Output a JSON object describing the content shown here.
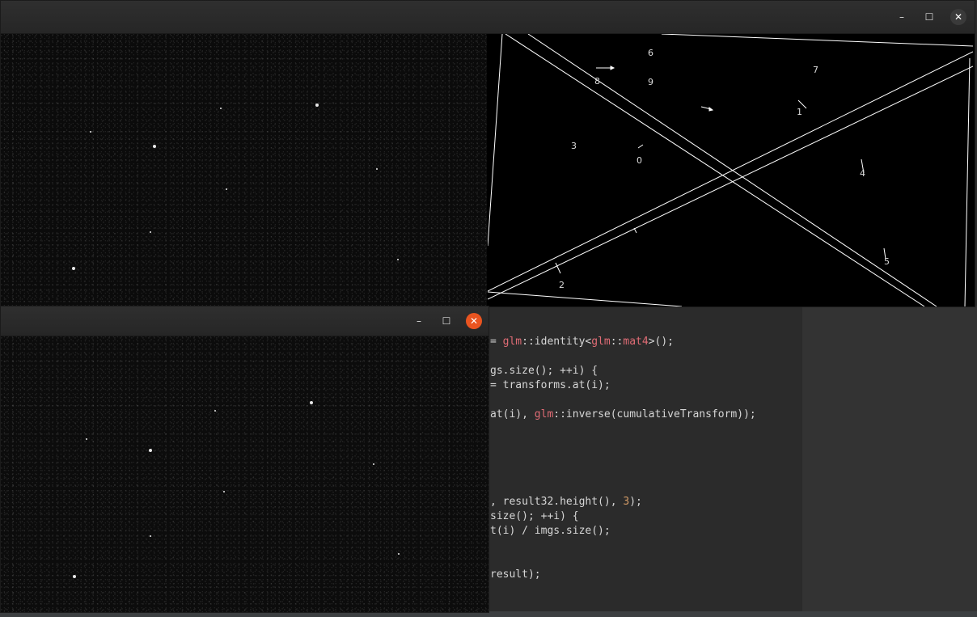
{
  "editor": {
    "lines": [
      {
        "parts": [
          {
            "t": "= ",
            "c": ""
          },
          {
            "t": "glm",
            "c": "kw"
          },
          {
            "t": "::identity<",
            "c": ""
          },
          {
            "t": "glm",
            "c": "kw"
          },
          {
            "t": "::",
            "c": ""
          },
          {
            "t": "mat4",
            "c": "kw"
          },
          {
            "t": ">();",
            "c": ""
          }
        ]
      },
      {
        "parts": [
          {
            "t": "gs.size(); ++i) {",
            "c": ""
          }
        ]
      },
      {
        "parts": [
          {
            "t": "= transforms.at(i);",
            "c": ""
          }
        ]
      },
      {
        "parts": [
          {
            "t": "at(i), ",
            "c": ""
          },
          {
            "t": "glm",
            "c": "kw"
          },
          {
            "t": "::inverse(cumulativeTransform));",
            "c": ""
          }
        ]
      },
      {
        "parts": [
          {
            "t": ", result32.height(), ",
            "c": ""
          },
          {
            "t": "3",
            "c": "num"
          },
          {
            "t": ");",
            "c": ""
          }
        ]
      },
      {
        "parts": [
          {
            "t": "size(); ++i) {",
            "c": ""
          }
        ]
      },
      {
        "parts": [
          {
            "t": "t(i) / imgs.size();",
            "c": ""
          }
        ]
      },
      {
        "parts": [
          {
            "t": "result);",
            "c": ""
          }
        ]
      }
    ]
  },
  "window_top": {
    "buttons": {
      "minimize": "–",
      "maximize": "☐",
      "close": "✕"
    },
    "markers": [
      "6",
      "7",
      "8",
      "9",
      "1",
      "3",
      "0",
      "4",
      "5",
      "2"
    ]
  },
  "window_bottom": {
    "buttons": {
      "minimize": "–",
      "maximize": "☐",
      "close": "✕"
    }
  }
}
